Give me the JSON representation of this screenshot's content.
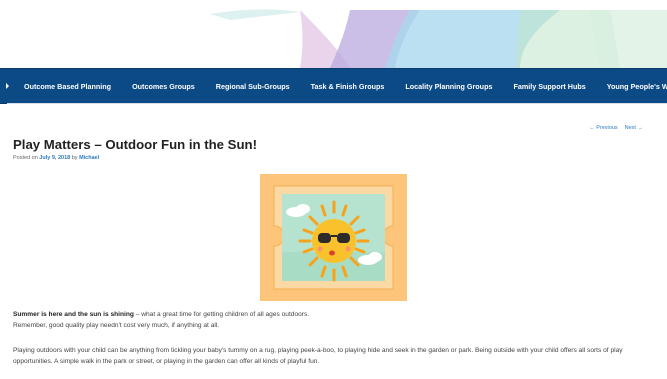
{
  "colors": {
    "nav_bg": "#0c4a86",
    "link": "#2a7bc0",
    "featured_bg": "#fcc57a",
    "featured_inner": "#b6e3cf",
    "sun": "#f7b21a"
  },
  "nav": {
    "items": [
      {
        "label": "Outcome Based Planning"
      },
      {
        "label": "Outcomes Groups"
      },
      {
        "label": "Regional Sub-Groups"
      },
      {
        "label": "Task & Finish Groups"
      },
      {
        "label": "Locality Planning Groups"
      },
      {
        "label": "Family Support Hubs"
      },
      {
        "label": "Young People's Webpa"
      }
    ]
  },
  "post_nav": {
    "previous": "← Previous",
    "next": "Next →"
  },
  "post": {
    "title": "Play Matters – Outdoor Fun in the Sun!",
    "meta_prefix": "Posted on ",
    "date": "July 9, 2018",
    "meta_by": " by ",
    "author": "Michael",
    "featured_image_icon": "sun-with-sunglasses-icon",
    "p1_lead": "Summer is here and the sun is shining",
    "p1_rest": " – what a great time for getting children of all ages outdoors. Remember, good quality play needn't cost very much, if anything at all.",
    "p2": "Playing outdoors with your child can be anything from tickling your baby's tummy on a rug, playing peek-a-boo, to playing hide and seek in the garden or park. Being outside with your child offers all sorts of play opportunities. A simple walk in the park or street, or playing in the garden can offer all kinds of playful fun."
  }
}
